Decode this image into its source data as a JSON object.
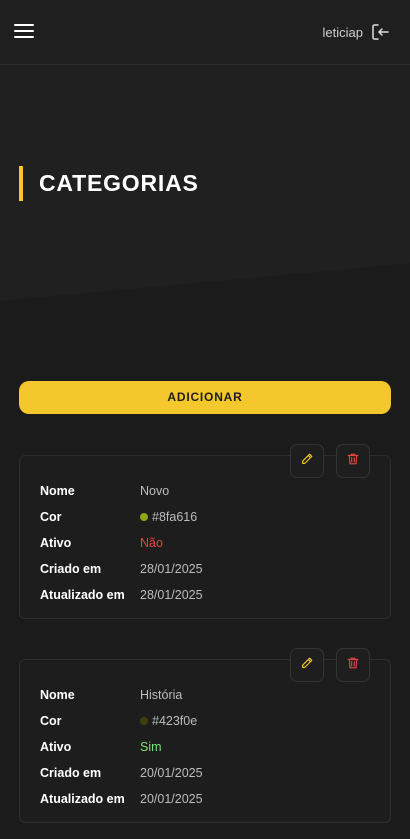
{
  "header": {
    "username": "leticiap",
    "menu_icon": "hamburger-menu-icon",
    "logout_icon": "logout-icon"
  },
  "page": {
    "title": "CATEGORIAS",
    "add_button_label": "ADICIONAR"
  },
  "field_labels": {
    "nome": "Nome",
    "cor": "Cor",
    "ativo": "Ativo",
    "criado_em": "Criado em",
    "atualizado_em": "Atualizado em"
  },
  "categories": [
    {
      "nome": "Novo",
      "cor": "#8fa616",
      "ativo": "Não",
      "criado_em": "28/01/2025",
      "atualizado_em": "28/01/2025"
    },
    {
      "nome": "História",
      "cor": "#423f0e",
      "ativo": "Sim",
      "criado_em": "20/01/2025",
      "atualizado_em": "20/01/2025"
    }
  ],
  "colors": {
    "accent": "#f4c82c",
    "danger": "#e04646",
    "success": "#7ee37b",
    "background": "#1b1b1b"
  }
}
